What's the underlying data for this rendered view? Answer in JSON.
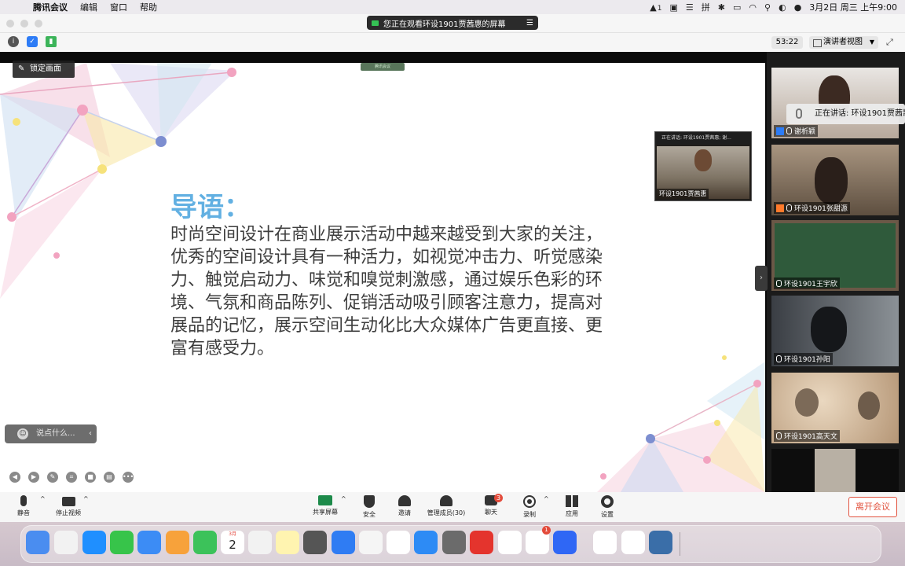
{
  "menubar": {
    "app_name": "腾讯会议",
    "menus": [
      "编辑",
      "窗口",
      "帮助"
    ],
    "notification_count": "1",
    "datetime": "3月2日 周三 上午9:00"
  },
  "titlebar": {
    "share_banner": "您正在观看环设1901贾茜惠的屏幕"
  },
  "subbar": {
    "timer": "53:22",
    "view_mode": "演讲者视图"
  },
  "stage": {
    "lock_label": "锁定画面",
    "mini_bar": "腾讯会议",
    "slide_title": "导语：",
    "slide_body": "时尚空间设计在商业展示活动中越来越受到大家的关注，优秀的空间设计具有一种活力，如视觉冲击力、听觉感染力、触觉启动力、味觉和嗅觉刺激感，通过娱乐色彩的环境、气氛和商品陈列、促销活动吸引顾客注意力，提高对展品的记忆，展示空间生动化比大众媒体广告更直接、更富有感受力。",
    "pip_header": "正在讲话: 环设1901贾茜惠; 谢...",
    "pip_name": "环设1901贾茜惠",
    "chat_placeholder": "说点什么..."
  },
  "gallery": {
    "speaking_tip": "正在讲话: 环设1901贾茜惠",
    "participants": [
      {
        "name": "谢析颖",
        "bg": "#cfc9c4"
      },
      {
        "name": "环设1901张甜源",
        "bg": "#8a7a66"
      },
      {
        "name": "环设1901王宇欣",
        "bg": "#2f5a3b"
      },
      {
        "name": "环设1901孙阳",
        "bg": "#4b5158"
      },
      {
        "name": "环设1901高天文",
        "bg": "#c7ae8f"
      },
      {
        "name": "",
        "bg": "#111111"
      }
    ]
  },
  "toolbar": {
    "mute": "静音",
    "stop_video": "停止视频",
    "share_screen": "共享屏幕",
    "security": "安全",
    "invite": "邀请",
    "manage_participants": "管理成员(30)",
    "chat": "聊天",
    "chat_badge": "3",
    "record": "录制",
    "apps": "应用",
    "settings": "设置",
    "leave": "离开会议"
  },
  "dock": {
    "calendar_month": "3月",
    "calendar_day": "2",
    "qq_badge": "1",
    "colors": [
      "#4a8df0",
      "#f2f2f2",
      "#1f8fff",
      "#37c44a",
      "#3c8cf5",
      "#f7a23b",
      "#3cc25a",
      "#ffffff",
      "#f2f2f2",
      "#fff4b0",
      "#555555",
      "#2f7cf3",
      "#f5f5f5",
      "#ffffff",
      "#2d8bf5",
      "#6b6b6b",
      "#e4342d",
      "#ffffff",
      "#ffffff",
      "#2f67f5",
      "#ffffff",
      "#ffffff",
      "#3a6ea8"
    ]
  }
}
